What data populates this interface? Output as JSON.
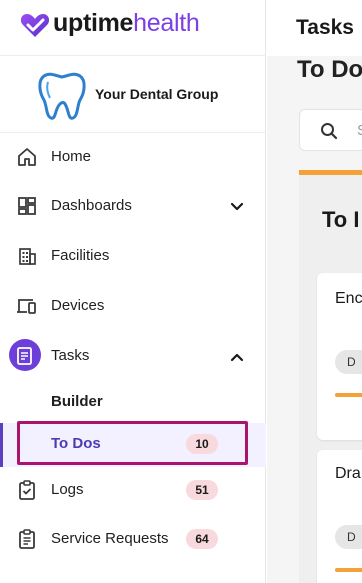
{
  "brand": {
    "name_bold": "uptime",
    "name_light": "health"
  },
  "org": {
    "name": "Your Dental Group"
  },
  "nav": {
    "home": "Home",
    "dashboards": "Dashboards",
    "facilities": "Facilities",
    "devices": "Devices",
    "tasks": "Tasks",
    "builder": "Builder",
    "todos": "To Dos",
    "todos_count": "10",
    "logs": "Logs",
    "logs_count": "51",
    "service_requests": "Service Requests",
    "service_requests_count": "64"
  },
  "main": {
    "topbar_title": "Tasks",
    "page_heading": "To Do",
    "search_placeholder": "S",
    "panel_title": "To I",
    "cards": [
      {
        "title": "Enc",
        "chip": "D"
      },
      {
        "title": "Dra",
        "chip": "D"
      }
    ]
  },
  "colors": {
    "accent": "#6b3fd8",
    "brand_purple": "#7b3fe4",
    "highlight_border": "#a8146e",
    "badge": "#f8d9dd",
    "orange": "#f5a13a"
  }
}
